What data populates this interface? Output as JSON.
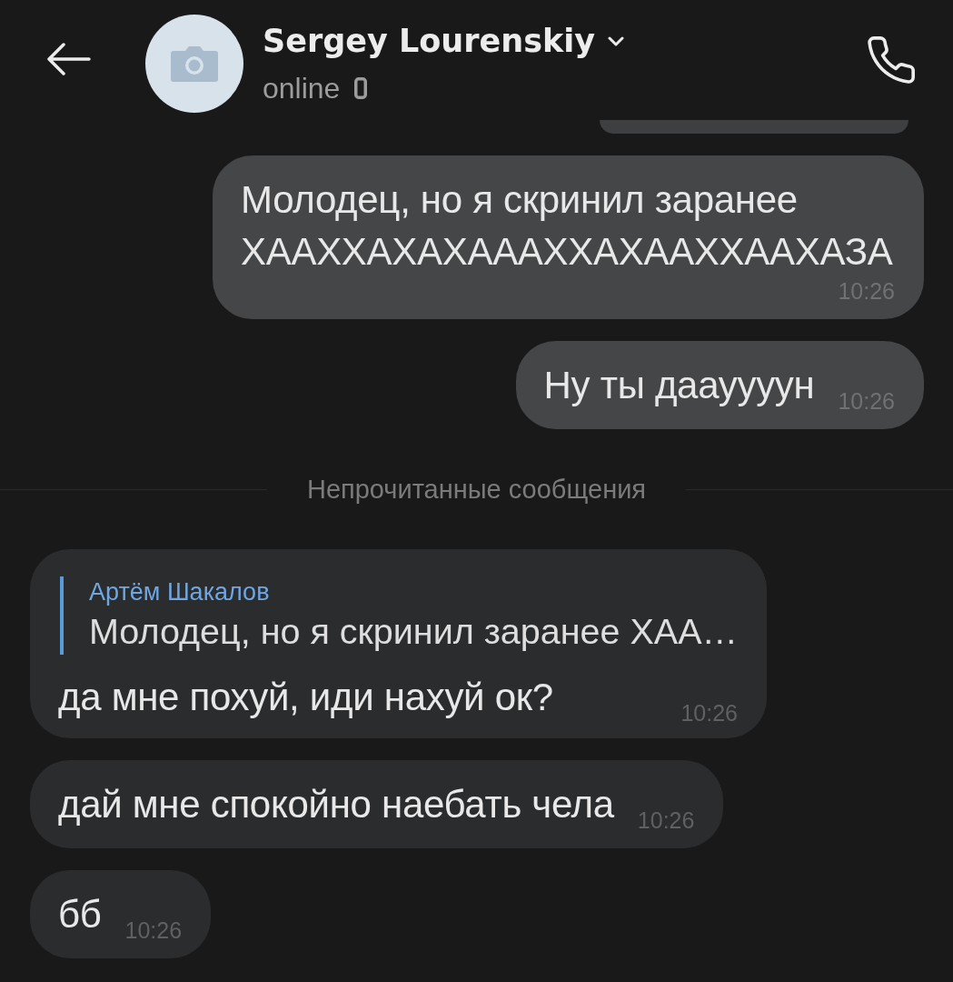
{
  "header": {
    "title": "Sergey Lourenskiy",
    "status": "online"
  },
  "messages": [
    {
      "kind": "partial",
      "outgoing": true
    },
    {
      "kind": "text",
      "outgoing": true,
      "text": "Молодец, но я скринил заранее ХААХХАХАХАААХХАХААХХААХАЗА",
      "time": "10:26"
    },
    {
      "kind": "text",
      "outgoing": true,
      "text": "Ну ты даауууун",
      "time": "10:26"
    },
    {
      "kind": "divider",
      "text": "Непрочитанные сообщения"
    },
    {
      "kind": "text",
      "outgoing": false,
      "reply": {
        "author": "Артём Шакалов",
        "text": "Молодец, но я скринил заранее ХАА…"
      },
      "text": "да мне похуй, иди нахуй ок?",
      "time": "10:26"
    },
    {
      "kind": "text",
      "outgoing": false,
      "text": "дай мне спокойно наебать чела",
      "time": "10:26"
    },
    {
      "kind": "text",
      "outgoing": false,
      "text": "бб",
      "time": "10:26"
    }
  ]
}
